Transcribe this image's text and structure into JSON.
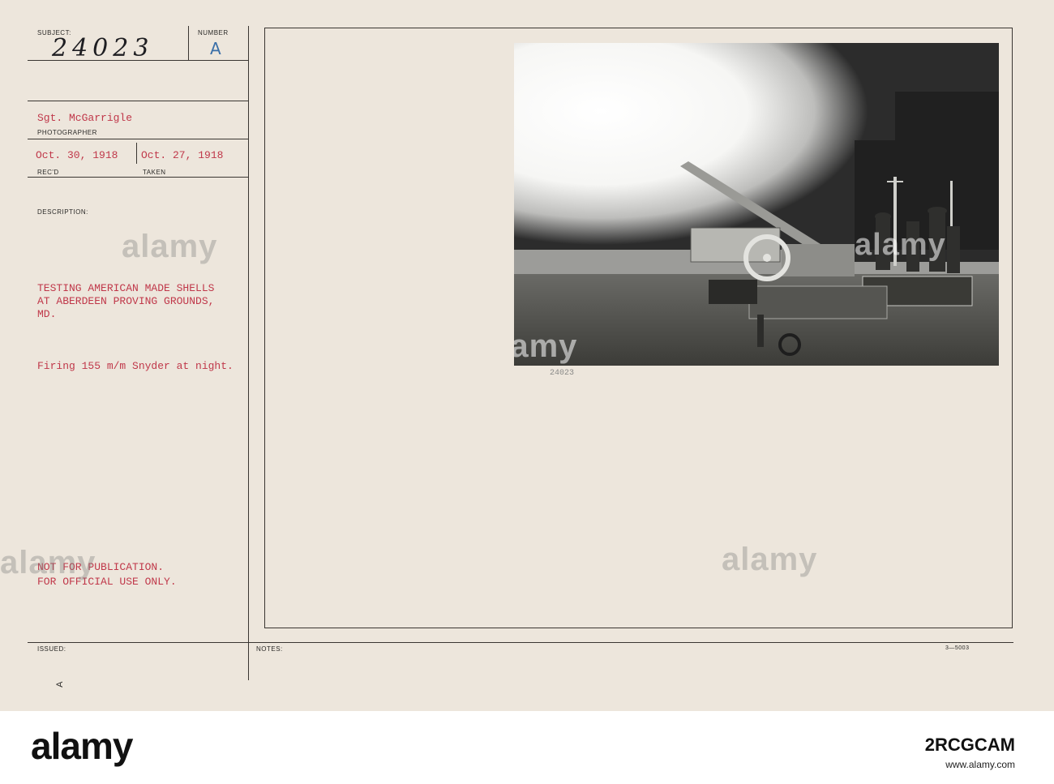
{
  "form": {
    "subject_label": "SUBJECT:",
    "number_label": "NUMBER",
    "subject_number": "24023",
    "number_letter": "A",
    "photographer_name": "Sgt. McGarrigle",
    "photographer_label": "PHOTOGRAPHER",
    "received_date": "Oct. 30, 1918",
    "received_label": "REC'D",
    "taken_date": "Oct. 27, 1918",
    "taken_label": "TAKEN",
    "description_label": "DESCRIPTION:",
    "description_lines": [
      "TESTING AMERICAN MADE SHELLS",
      "AT ABERDEEN PROVING GROUNDS,",
      "MD."
    ],
    "caption": "Firing 155 m/m Snyder at night.",
    "restriction_lines": [
      "NOT FOR PUBLICATION.",
      "FOR OFFICIAL USE ONLY."
    ],
    "issued_label": "ISSUED:",
    "notes_label": "NOTES:",
    "form_code": "3—5003",
    "photo_number": "24023",
    "corner_mark": "A"
  },
  "watermark": {
    "text": "alamy"
  },
  "footer": {
    "brand": "alamy",
    "image_code": "2RCGCAM",
    "site": "www.alamy.com"
  },
  "colors": {
    "card": "#ede6dc",
    "typed_red": "#c0384a",
    "ink": "#3a3632",
    "stamp_blue": "#3a6fa8"
  }
}
